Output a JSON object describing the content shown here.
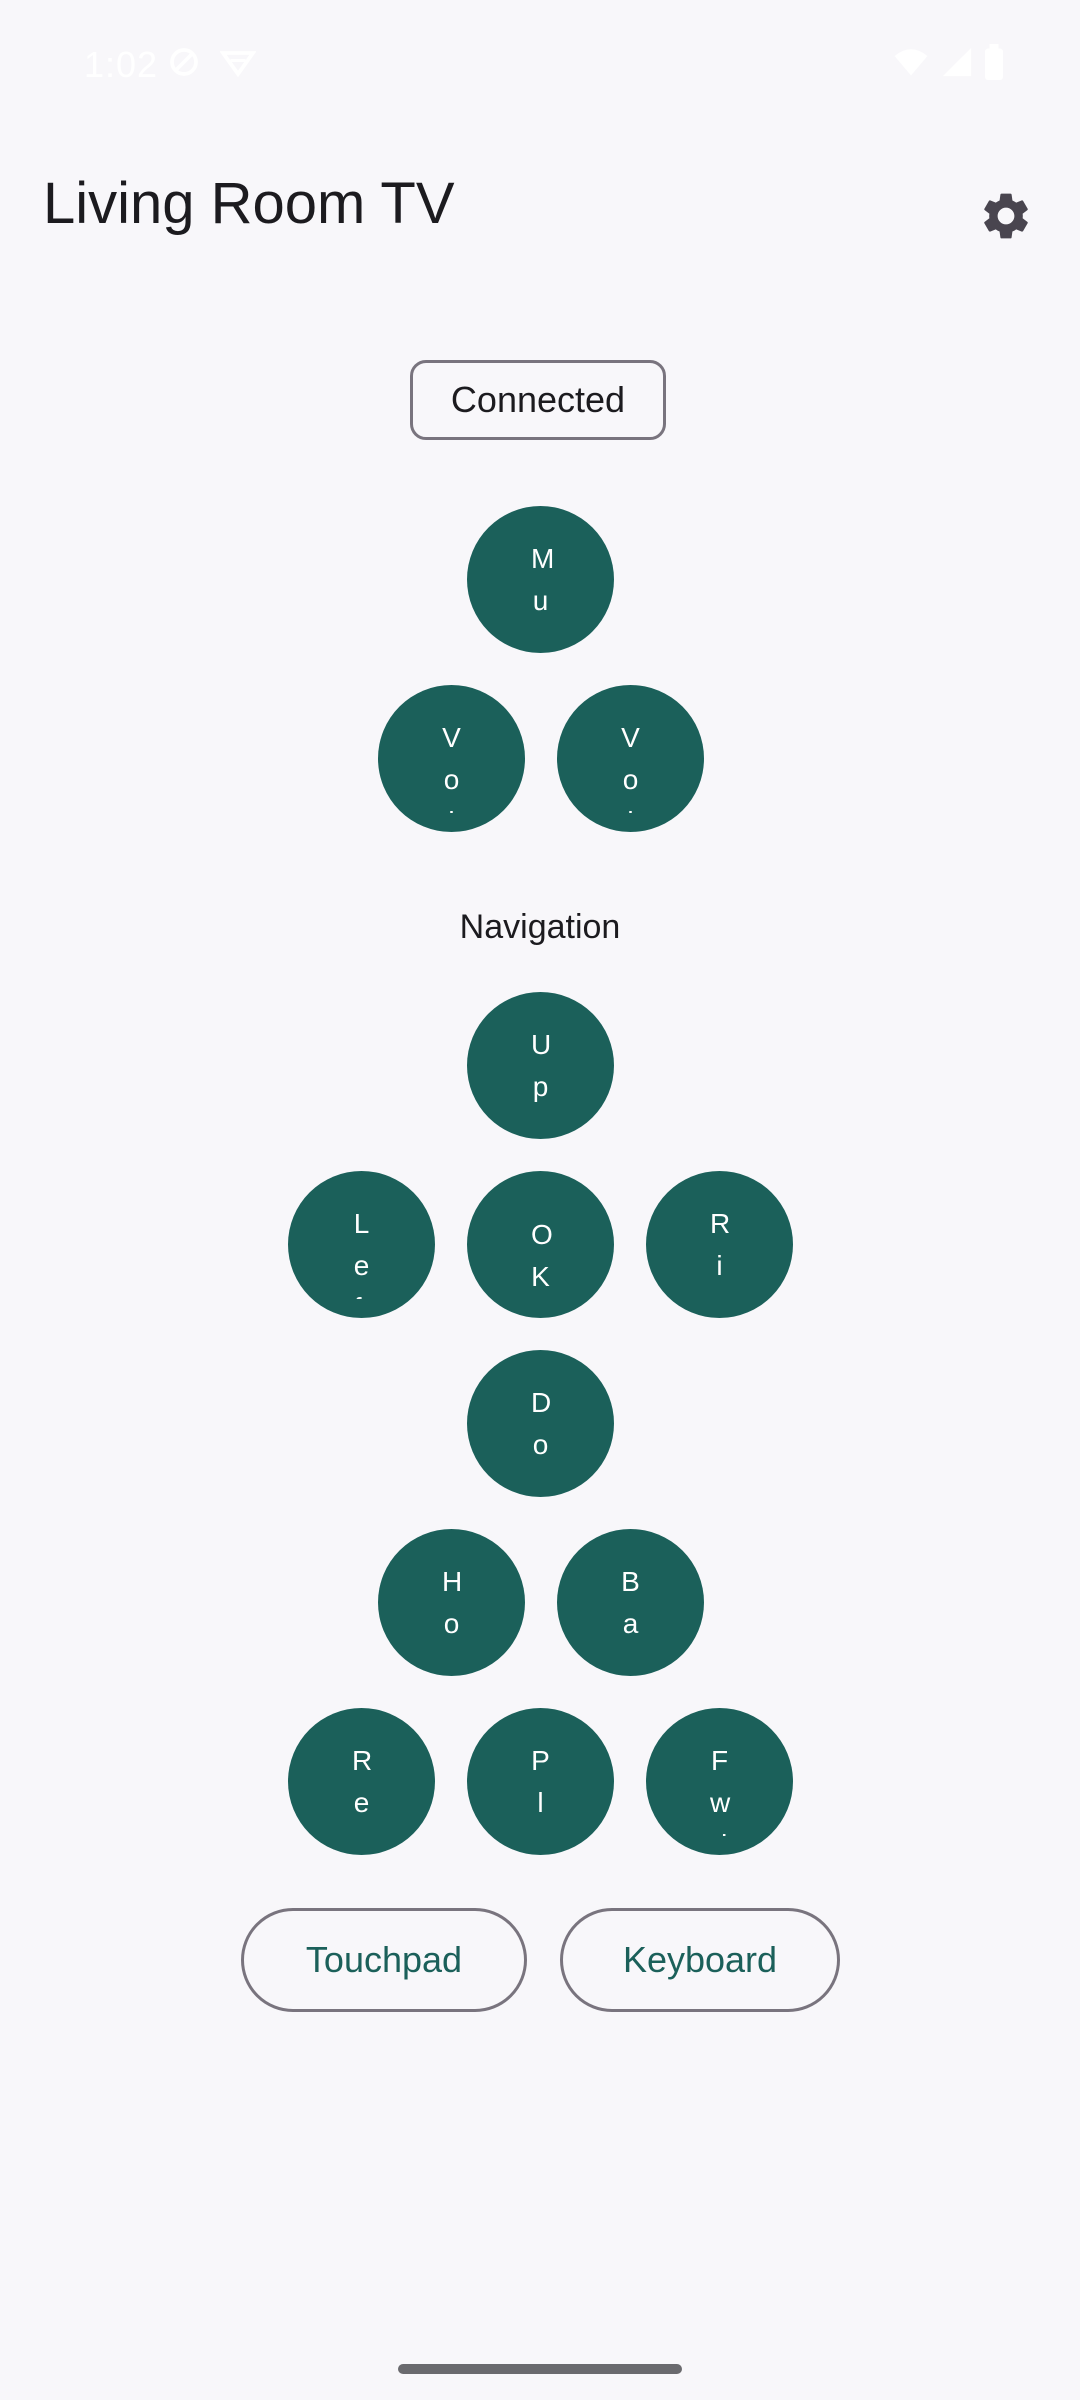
{
  "status_bar": {
    "time": "1:02"
  },
  "header": {
    "title": "Living Room TV",
    "settings_icon": "gear-icon"
  },
  "connection": {
    "status": "Connected"
  },
  "volume": {
    "mute": "Mute",
    "vol_down": "Vol",
    "vol_up": "Vol"
  },
  "navigation": {
    "title": "Navigation",
    "up": "Up",
    "left": "Left",
    "ok": "OK",
    "right": "Right",
    "down": "Down"
  },
  "system": {
    "home": "Home",
    "back": "Back"
  },
  "media": {
    "rewind": "Rev",
    "play": "Play",
    "forward": "Fwd"
  },
  "modes": {
    "touchpad": "Touchpad",
    "keyboard": "Keyboard"
  },
  "colors": {
    "accent": "#1b605a",
    "background": "#f8f7fa",
    "outline": "#79747e"
  }
}
